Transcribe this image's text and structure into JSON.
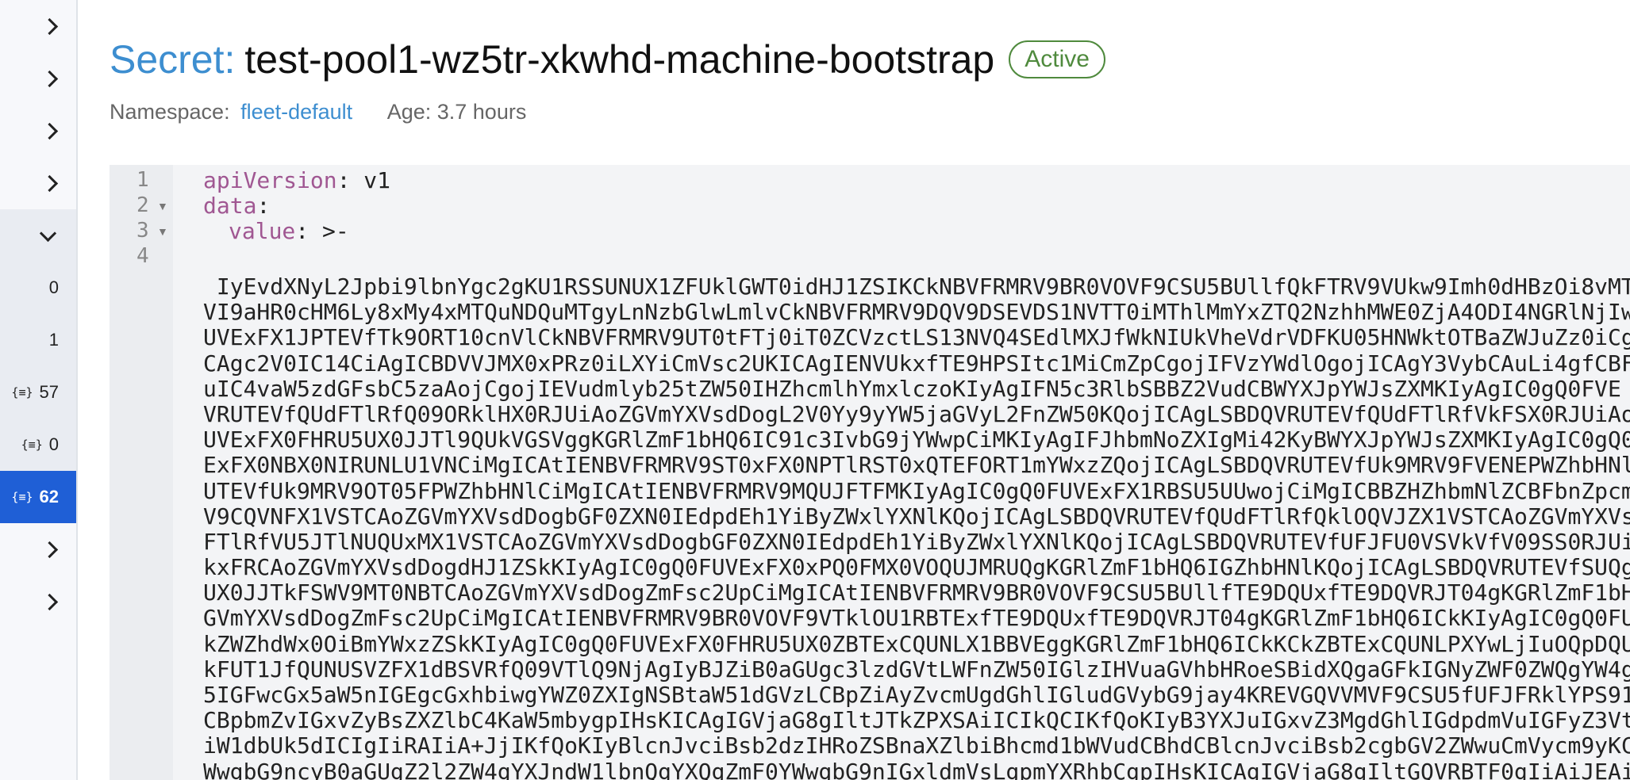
{
  "sidebar": {
    "counts": [
      "0",
      "1",
      "57",
      "0",
      "62"
    ]
  },
  "header": {
    "type_label": "Secret:",
    "name": "test-pool1-wz5tr-xkwhd-machine-bootstrap",
    "status": "Active"
  },
  "meta": {
    "namespace_label": "Namespace:",
    "namespace_value": "fleet-default",
    "age": "Age: 3.7 hours"
  },
  "editor": {
    "line_numbers": [
      "1",
      "2",
      "3",
      "4"
    ],
    "line1_key": "apiVersion",
    "line1_rest": ": v1",
    "line2_key": "data",
    "line2_rest": ":",
    "line3_key": "value",
    "line3_rest": ": >-",
    "blob": [
      " IyEvdXNyL2Jpbi9lbnYgc2gKU1RSSUNUX1ZFUklGWT0idHJ1ZSIKCkNBVFRMRV9BR0VOVF9CSU5BUllfQkFTRV9VUkw9Imh0dHBzOi8vMT",
      "VI9aHR0cHM6Ly8xMy4xMTQuNDQuMTgyLnNzbGlwLmlvCkNBVFRMRV9DQV9DSEVDS1NVTT0iMThlMmYxZTQ2NzhhMWE0ZjA4ODI4NGRlNjIw",
      "UVExFX1JPTEVfTk9ORT10cnVlCkNBVFRMRV9UT0tFTj0iT0ZCVzctLS13NVQ4SEdlMXJfWkNIUkVheVdrVDFKU05HNWktOTBaZWJuZz0iCg",
      "CAgc2V0IC14CiAgICBDVVJMX0xPRz0iLXYiCmVsc2UKICAgIENVUkxfTE9HPSItc1MiCmZpCgojIFVzYWdlOgojICAgY3VybCAuLi4gfCBF",
      "uIC4vaW5zdGFsbC5zaAojCgojIEVudmlyb25tZW50IHZhcmlhYmxlczoKIyAgIFN5c3RlbSBBZ2VudCBWYXJpYWJsZXMKIyAgIC0gQ0FVE",
      "VRUTEVfQUdFTlRfQ09ORklHX0RJUiAoZGVmYXVsdDogL2V0Yy9yYW5jaGVyL2FnZW50KQojICAgLSBDQVRUTEVfQUdFTlRfVkFSX0RJUiAo",
      "UVExFX0FHRU5UX0JJTl9QUkVGSVggKGRlZmF1bHQ6IC91c3IvbG9jYWwpCiMKIyAgIFJhbmNoZXIgMi42KyBWYXJpYWJsZXMKIyAgIC0gQ0",
      "ExFX0NBX0NIRUNLU1VNCiMgICAtIENBVFRMRV9ST0xFX0NPTlRST0xQTEFORT1mYWxzZQojICAgLSBDQVRUTEVfUk9MRV9FVENEPWZhbHNl",
      "UTEVfUk9MRV9OT05FPWZhbHNlCiMgICAtIENBVFRMRV9MQUJFTFMKIyAgIC0gQ0FUVExFX1RBSU5UUwojCiMgICBBZHZhbmNlZCBFbnZpcm",
      "V9CQVNFX1VSTCAoZGVmYXVsdDogbGF0ZXN0IEdpdEh1YiByZWxlYXNlKQojICAgLSBDQVRUTEVfQUdFTlRfQklOQVJZX1VSTCAoZGVmYXVs",
      "FTlRfVU5JTlNUQUxMX1VSTCAoZGVmYXVsdDogbGF0ZXN0IEdpdEh1YiByZWxlYXNlKQojICAgLSBDQVRUTEVfUFJFU0VSVkVfV09SS0RJUi",
      "kxFRCAoZGVmYXVsdDogdHJ1ZSkKIyAgIC0gQ0FUVExFX0xPQ0FMX0VOQUJMRUQgKGRlZmF1bHQ6IGZhbHNlKQojICAgLSBDQVRUTEVfSUQg",
      "UX0JJTkFSWV9MT0NBTCAoZGVmYXVsdDogZmFsc2UpCiMgICAtIENBVFRMRV9BR0VOVF9CSU5BUllfTE9DQUxfTE9DQVRJT04gKGRlZmF1bH",
      "GVmYXVsdDogZmFsc2UpCiMgICAtIENBVFRMRV9BR0VOVF9VTklOU1RBTExfTE9DQUxfTE9DQVRJT04gKGRlZmF1bHQ6ICkKIyAgIC0gQ0FU",
      "kZWZhdWx0OiBmYWxzZSkKIyAgIC0gQ0FUVExFX0FHRU5UX0ZBTExCQUNLX1BBVEggKGRlZmF1bHQ6ICkKCkZBTExCQUNLPXYwLjIuOQpDQU",
      "kFUT1JfQUNUSVZFX1dBSVRfQ09VTlQ9NjAgIyBJZiB0aGUgc3lzdGVtLWFnZW50IGlzIHVuaGVhbHRoeSBidXQgaGFkIGNyZWF0ZWQgYW4g",
      "5IGFwcGx5aW5nIGEgcGxhbiwgYWZ0ZXIgNSBtaW51dGVzLCBpZiAyZvcmUgdGhlIGludGVybG9jay4KREVGQVVMVF9CSU5fUFJFRklYPS91c3",
      "CBpbmZvIGxvZyBsZXZlbC4KaW5mbygpIHsKICAgIGVjaG8gIltJTkZPXSAiICIkQCIKfQoKIyB3YXJuIGxvZ3MgdGhlIGdpdmVuIGFyZ3Vt",
      "iW1dbUk5dICIgIiRAIiA+JjIKfQoKIyBlcnJvciBsb2dzIHRoZSBnaXZlbiBhcmd1bWVudCBhdCBlcnJvciBsb2cgbGV2ZWwuCmVycm9yKC",
      "WwgbG9ncyB0aGUgZ2l2ZW4gYXJndW1lbnQgYXQgZmF0YWwgbG9nIGxldmVsLgpmYXRhbCgpIHsKICAgIGVjaG8gIltGQVRBTF0gIiAiJEAi"
    ]
  }
}
